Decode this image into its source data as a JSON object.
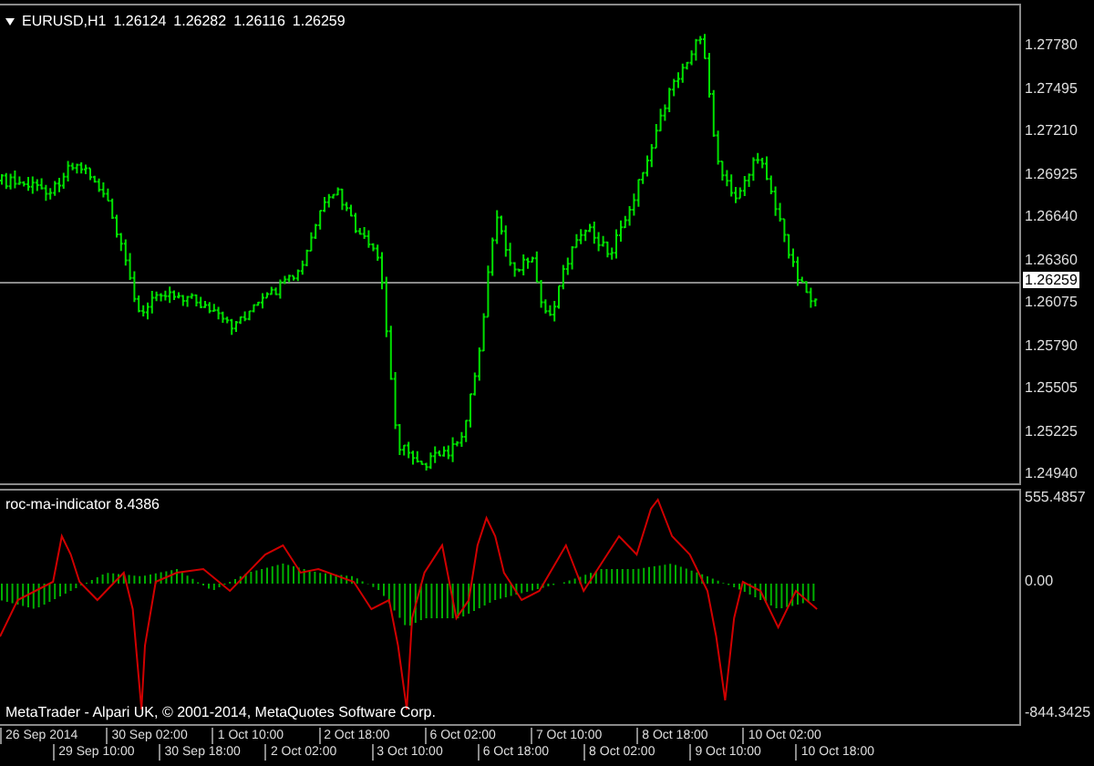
{
  "main_chart": {
    "symbol": "EURUSD,H1",
    "ohlc": [
      "1.26124",
      "1.26282",
      "1.26116",
      "1.26259"
    ],
    "price_axis": [
      "1.27780",
      "1.27495",
      "1.27210",
      "1.26925",
      "1.26640",
      "1.26360",
      "1.26075",
      "1.25790",
      "1.25505",
      "1.25225",
      "1.24940"
    ],
    "current_price": "1.26259"
  },
  "indicator": {
    "label": "roc-ma-indicator 8.4386",
    "axis": [
      "555.4857",
      "0.00",
      "-844.3425"
    ]
  },
  "copyright": "MetaTrader - Alpari UK, © 2001-2014, MetaQuotes Software Corp.",
  "time_axis": [
    "26 Sep 2014",
    "29 Sep 10:00",
    "30 Sep 02:00",
    "30 Sep 18:00",
    "1 Oct 10:00",
    "2 Oct 02:00",
    "2 Oct 18:00",
    "3 Oct 10:00",
    "6 Oct 02:00",
    "6 Oct 18:00",
    "7 Oct 10:00",
    "8 Oct 02:00",
    "8 Oct 18:00",
    "9 Oct 10:00",
    "10 Oct 02:00",
    "10 Oct 18:00"
  ]
}
